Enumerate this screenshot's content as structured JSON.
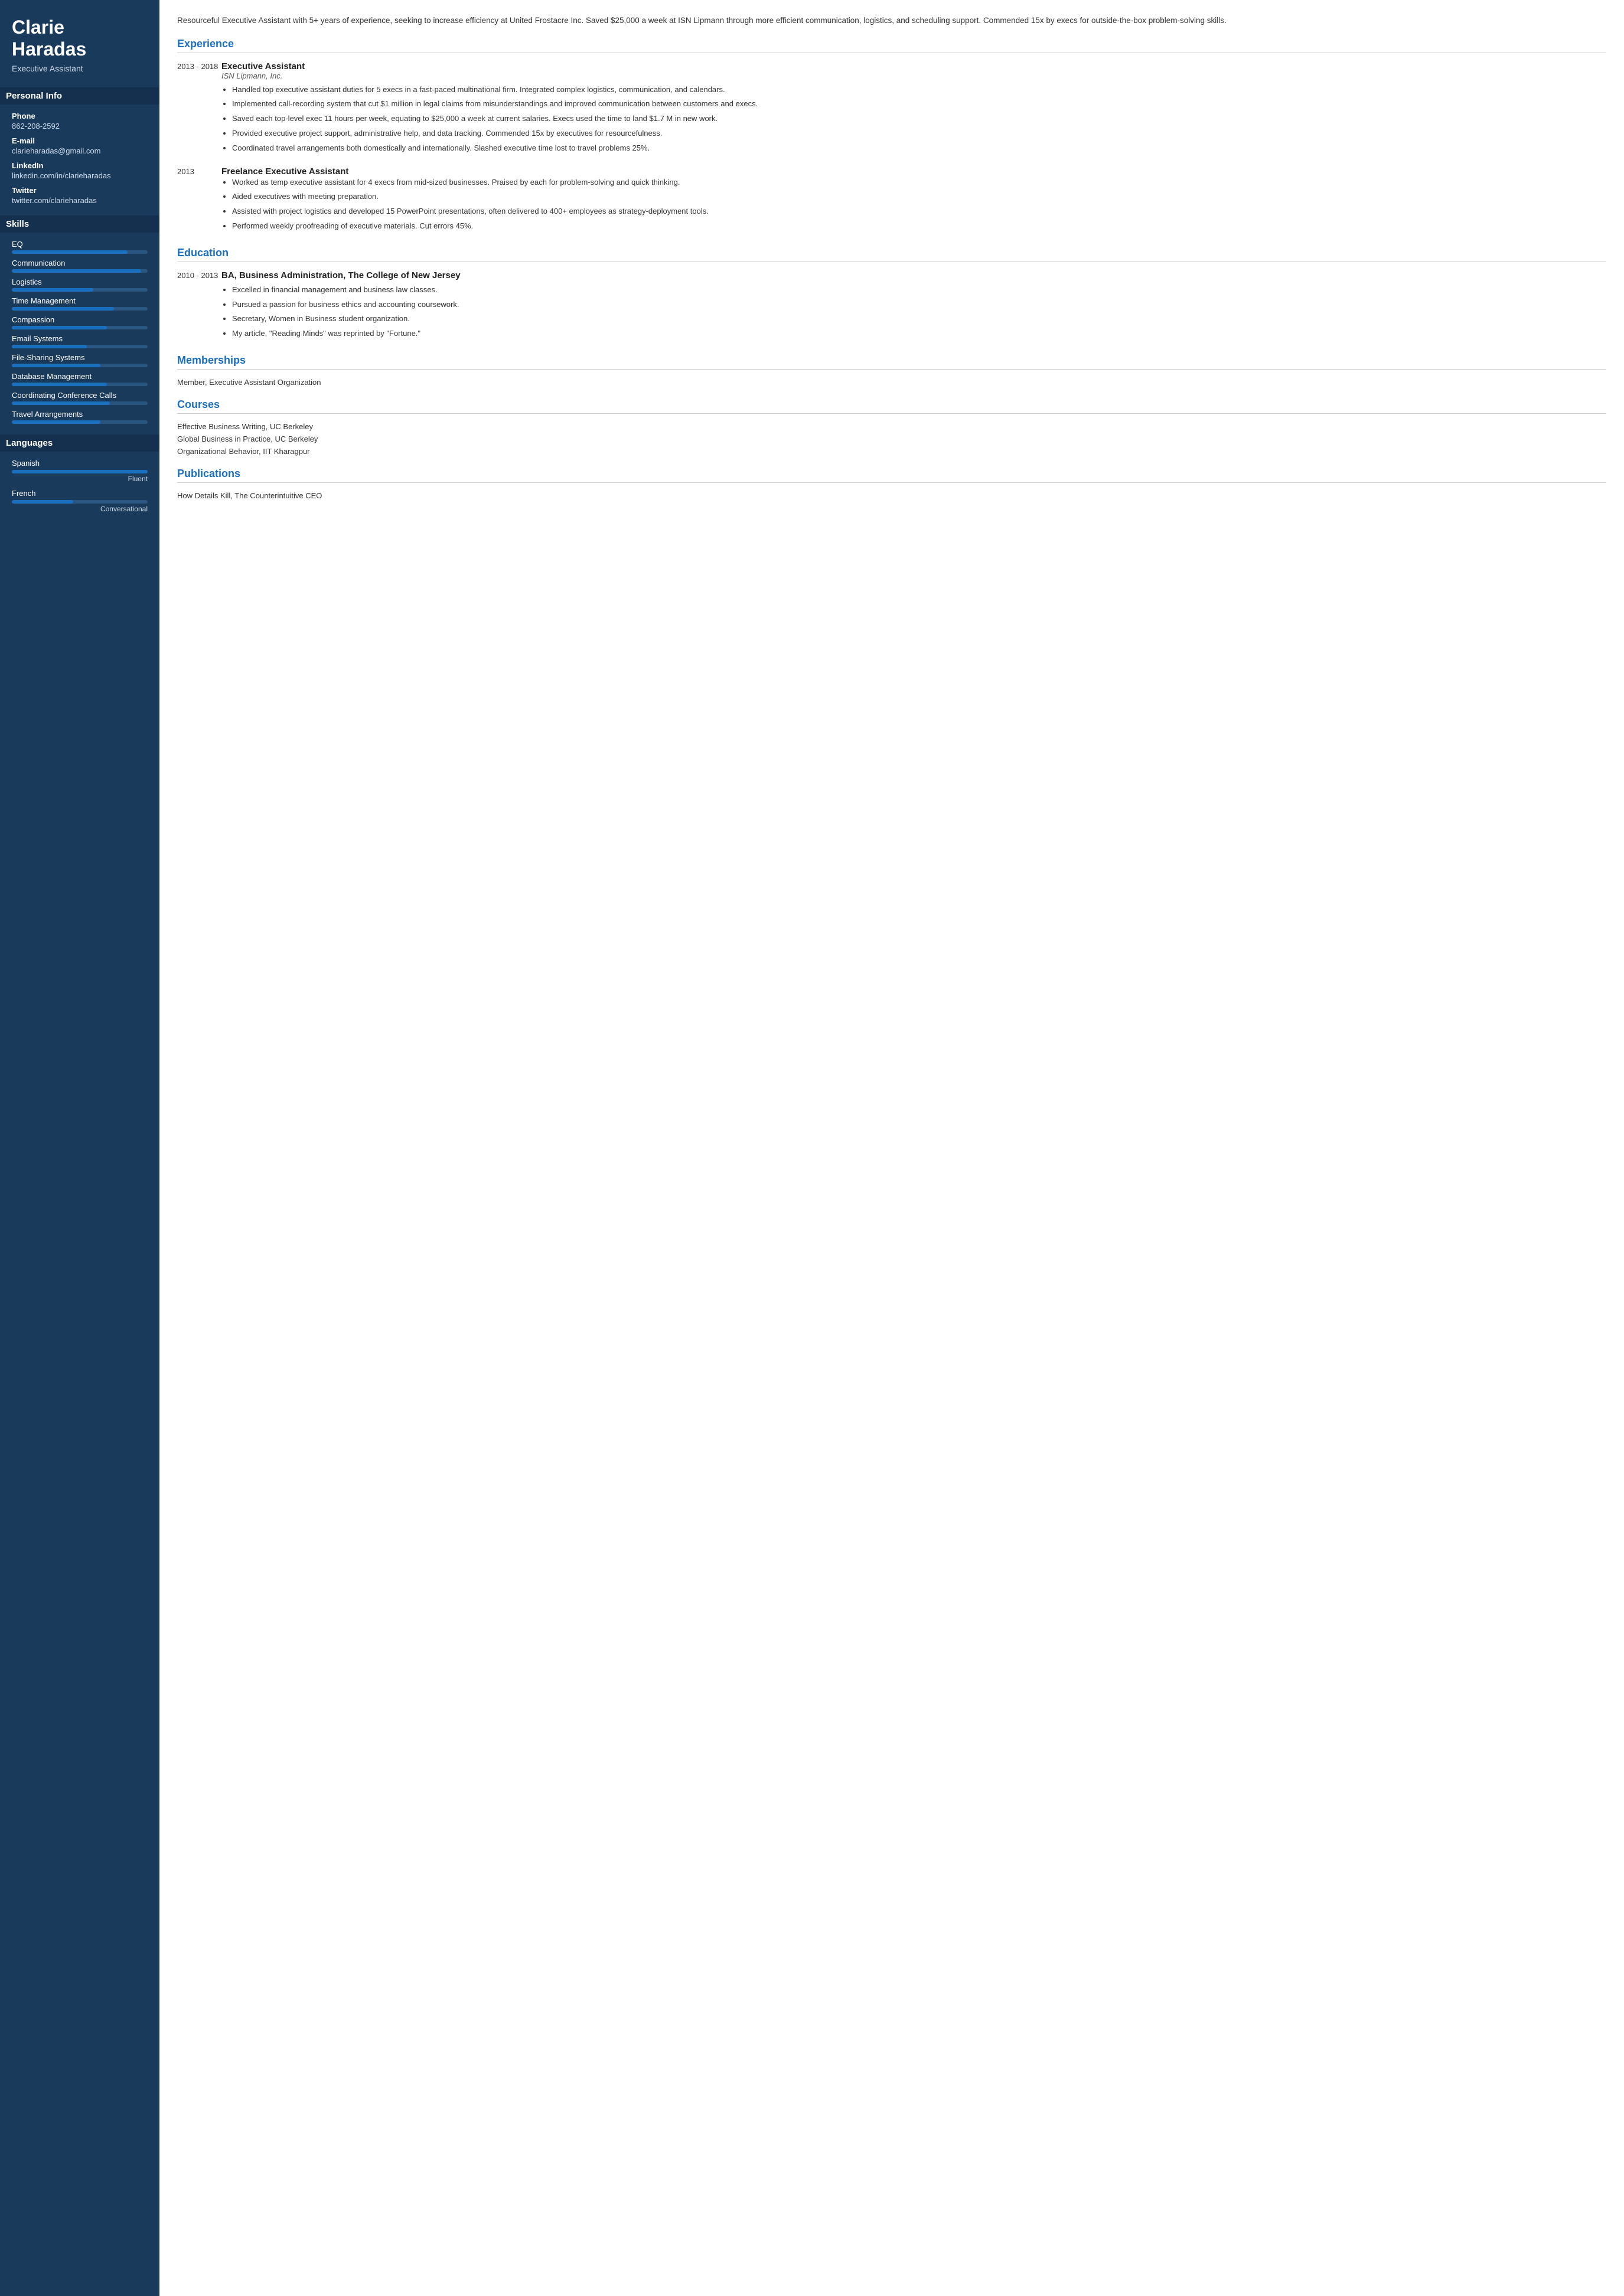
{
  "sidebar": {
    "name_line1": "Clarie",
    "name_line2": "Haradas",
    "title": "Executive Assistant",
    "sections": {
      "personal_info": "Personal Info",
      "skills_title": "Skills",
      "languages_title": "Languages"
    },
    "contact": {
      "phone_label": "Phone",
      "phone_value": "862-208-2592",
      "email_label": "E-mail",
      "email_value": "clarieharadas@gmail.com",
      "linkedin_label": "LinkedIn",
      "linkedin_value": "linkedin.com/in/clarieharadas",
      "twitter_label": "Twitter",
      "twitter_value": "twitter.com/clarieharadas"
    },
    "skills": [
      {
        "name": "EQ",
        "pct": 85
      },
      {
        "name": "Communication",
        "pct": 95
      },
      {
        "name": "Logistics",
        "pct": 60
      },
      {
        "name": "Time Management",
        "pct": 75
      },
      {
        "name": "Compassion",
        "pct": 70
      },
      {
        "name": "Email Systems",
        "pct": 55
      },
      {
        "name": "File-Sharing Systems",
        "pct": 65
      },
      {
        "name": "Database Management",
        "pct": 70
      },
      {
        "name": "Coordinating Conference Calls",
        "pct": 72
      },
      {
        "name": "Travel Arrangements",
        "pct": 65
      }
    ],
    "languages": [
      {
        "name": "Spanish",
        "pct": 100,
        "level": "Fluent"
      },
      {
        "name": "French",
        "pct": 45,
        "level": "Conversational"
      }
    ]
  },
  "main": {
    "summary": "Resourceful Executive Assistant with 5+ years of experience, seeking to increase efficiency at United Frostacre Inc. Saved $25,000 a week at ISN Lipmann through more efficient communication, logistics, and scheduling support. Commended 15x by execs for outside-the-box problem-solving skills.",
    "experience_title": "Experience",
    "jobs": [
      {
        "dates": "2013 - 2018",
        "title": "Executive Assistant",
        "company": "ISN Lipmann, Inc.",
        "bullets": [
          "Handled top executive assistant duties for 5 execs in a fast-paced multinational firm. Integrated complex logistics, communication, and calendars.",
          "Implemented call-recording system that cut $1 million in legal claims from misunderstandings and improved communication between customers and execs.",
          "Saved each top-level exec 11 hours per week, equating to $25,000 a week at current salaries. Execs used the time to land $1.7 M in new work.",
          "Provided executive project support, administrative help, and data tracking. Commended 15x by executives for resourcefulness.",
          "Coordinated travel arrangements both domestically and internationally. Slashed executive time lost to travel problems 25%."
        ]
      },
      {
        "dates": "2013",
        "title": "Freelance Executive Assistant",
        "company": "",
        "bullets": [
          "Worked as temp executive assistant for 4 execs from mid-sized businesses. Praised by each for problem-solving and quick thinking.",
          "Aided executives with meeting preparation.",
          "Assisted with project logistics and developed 15 PowerPoint presentations, often delivered to 400+ employees as strategy-deployment tools.",
          "Performed weekly proofreading of executive materials. Cut errors 45%."
        ]
      }
    ],
    "education_title": "Education",
    "education": [
      {
        "dates": "2010 - 2013",
        "degree": "BA, Business Administration, The College of New Jersey",
        "bullets": [
          "Excelled in financial management and business law classes.",
          "Pursued a passion for business ethics and accounting coursework.",
          "Secretary, Women in Business student organization.",
          "My article, \"Reading Minds\" was reprinted by \"Fortune.\""
        ]
      }
    ],
    "memberships_title": "Memberships",
    "memberships": [
      "Member, Executive Assistant Organization"
    ],
    "courses_title": "Courses",
    "courses": [
      "Effective Business Writing, UC Berkeley",
      "Global Business in Practice, UC Berkeley",
      "Organizational Behavior, IIT Kharagpur"
    ],
    "publications_title": "Publications",
    "publications": [
      "How Details Kill, The Counterintuitive CEO"
    ]
  }
}
